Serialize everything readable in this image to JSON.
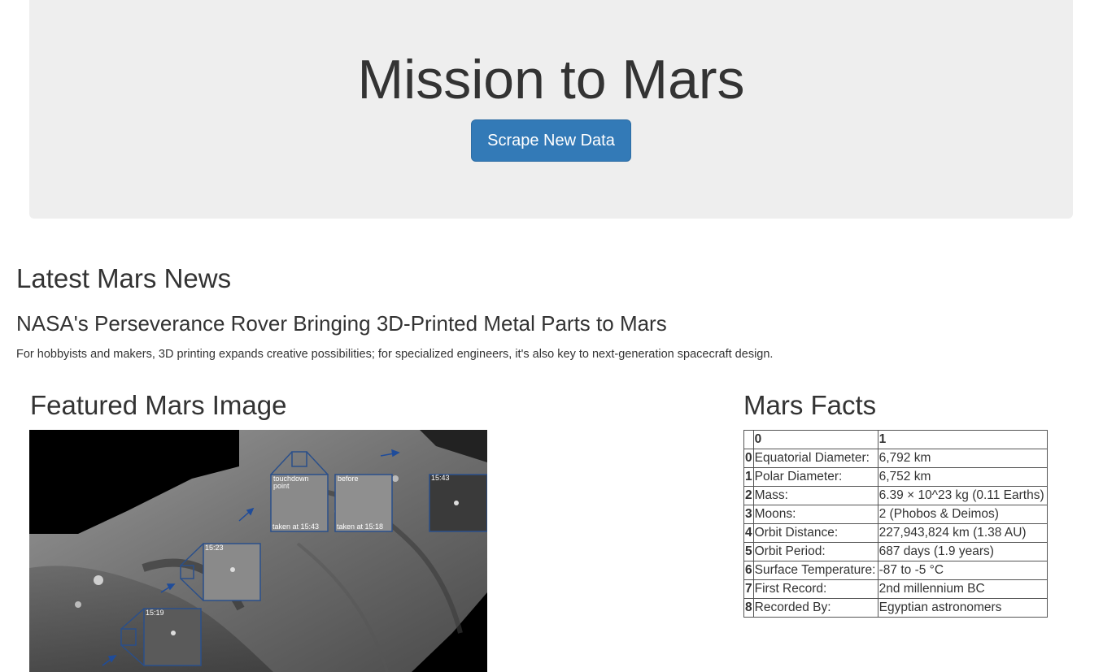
{
  "header": {
    "title": "Mission to Mars",
    "scrape_button_label": "Scrape New Data"
  },
  "news": {
    "section_heading": "Latest Mars News",
    "title": "NASA's Perseverance Rover Bringing 3D-Printed Metal Parts to Mars",
    "teaser": "For hobbyists and makers, 3D printing expands creative possibilities; for specialized engineers, it's also key to next-generation spacecraft design."
  },
  "featured": {
    "section_heading": "Featured Mars Image",
    "image_labels": {
      "touchdown": "touchdown point",
      "before": "before",
      "taken_1543": "taken at 15:43",
      "taken_1518": "taken at 15:18",
      "t1543": "15:43",
      "t1523": "15:23",
      "t1519": "15:19"
    }
  },
  "facts": {
    "section_heading": "Mars Facts",
    "columns": [
      "",
      "0",
      "1"
    ],
    "rows": [
      {
        "idx": "0",
        "label": "Equatorial Diameter:",
        "value": "6,792 km"
      },
      {
        "idx": "1",
        "label": "Polar Diameter:",
        "value": "6,752 km"
      },
      {
        "idx": "2",
        "label": "Mass:",
        "value": "6.39 × 10^23 kg (0.11 Earths)"
      },
      {
        "idx": "3",
        "label": "Moons:",
        "value": "2 (Phobos & Deimos)"
      },
      {
        "idx": "4",
        "label": "Orbit Distance:",
        "value": "227,943,824 km (1.38 AU)"
      },
      {
        "idx": "5",
        "label": "Orbit Period:",
        "value": "687 days (1.9 years)"
      },
      {
        "idx": "6",
        "label": "Surface Temperature:",
        "value": "-87 to -5 °C"
      },
      {
        "idx": "7",
        "label": "First Record:",
        "value": "2nd millennium BC"
      },
      {
        "idx": "8",
        "label": "Recorded By:",
        "value": "Egyptian astronomers"
      }
    ]
  },
  "colors": {
    "primary_button": "#337ab7",
    "jumbotron_bg": "#eeeeee",
    "text": "#333333",
    "inset_frame": "#2a4f8a"
  }
}
